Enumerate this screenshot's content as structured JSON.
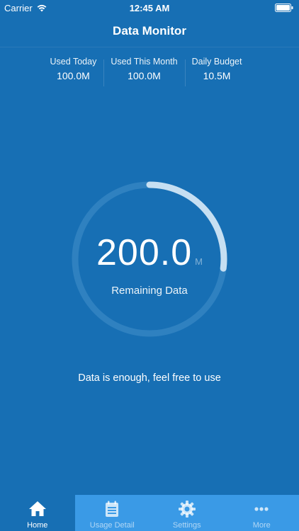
{
  "status_bar": {
    "carrier": "Carrier",
    "time": "12:45 AM",
    "wifi_icon": "wifi-icon",
    "battery_icon": "battery-icon"
  },
  "nav": {
    "title": "Data Monitor"
  },
  "stats": [
    {
      "label": "Used Today",
      "value": "100.0M"
    },
    {
      "label": "Used This Month",
      "value": "100.0M"
    },
    {
      "label": "Daily Budget",
      "value": "10.5M"
    }
  ],
  "gauge": {
    "value": "200.0",
    "unit": "M",
    "caption": "Remaining Data",
    "progress_fraction": 0.27
  },
  "message": "Data is enough, feel free to use",
  "tabs": [
    {
      "label": "Home",
      "icon": "home-icon",
      "active": true
    },
    {
      "label": "Usage Detail",
      "icon": "calendar-icon",
      "active": false
    },
    {
      "label": "Settings",
      "icon": "gear-icon",
      "active": false
    },
    {
      "label": "More",
      "icon": "more-icon",
      "active": false
    }
  ],
  "colors": {
    "background": "#176fb4",
    "tab_bar": "#3a9ae6",
    "gauge_progress": "#c6dff2",
    "gauge_track": "#2f81c0"
  }
}
